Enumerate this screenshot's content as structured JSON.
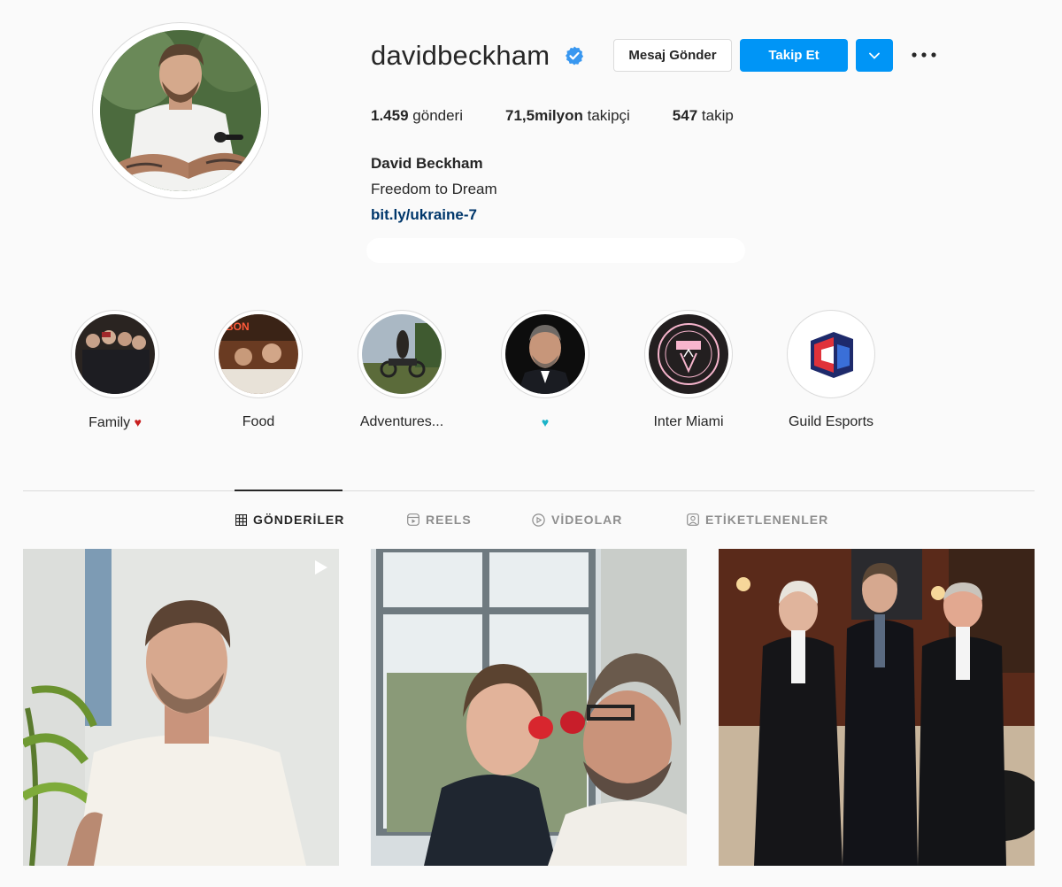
{
  "profile": {
    "username": "davidbeckham",
    "verified": true,
    "message_button": "Mesaj Gönder",
    "follow_button": "Takip Et",
    "stats": {
      "posts_count": "1.459",
      "posts_label": "gönderi",
      "followers_count": "71,5milyon",
      "followers_label": "takipçi",
      "following_count": "547",
      "following_label": "takip"
    },
    "full_name": "David Beckham",
    "bio": "Freedom to Dream",
    "link": "bit.ly/ukraine-7"
  },
  "highlights": [
    {
      "label": "Family",
      "suffix": "♥",
      "suffix_color": "#c81e1e"
    },
    {
      "label": "Food",
      "suffix": ""
    },
    {
      "label": "Adventures...",
      "suffix": ""
    },
    {
      "label": "",
      "suffix": "♥",
      "suffix_color": "#1bb3c8"
    },
    {
      "label": "Inter Miami",
      "suffix": ""
    },
    {
      "label": "Guild Esports",
      "suffix": ""
    }
  ],
  "tabs": [
    {
      "label": "GÖNDERİLER",
      "icon": "grid-icon",
      "active": true
    },
    {
      "label": "REELS",
      "icon": "reels-icon",
      "active": false
    },
    {
      "label": "VİDEOLAR",
      "icon": "video-icon",
      "active": false
    },
    {
      "label": "ETİKETLENENLER",
      "icon": "tagged-icon",
      "active": false
    }
  ],
  "posts": [
    {
      "type": "reel",
      "icon": "reel-play-icon"
    },
    {
      "type": "photo"
    },
    {
      "type": "photo"
    }
  ],
  "colors": {
    "accent": "#0095f6",
    "link": "#00376b",
    "verified": "#3897f0",
    "background": "#fafafa"
  }
}
